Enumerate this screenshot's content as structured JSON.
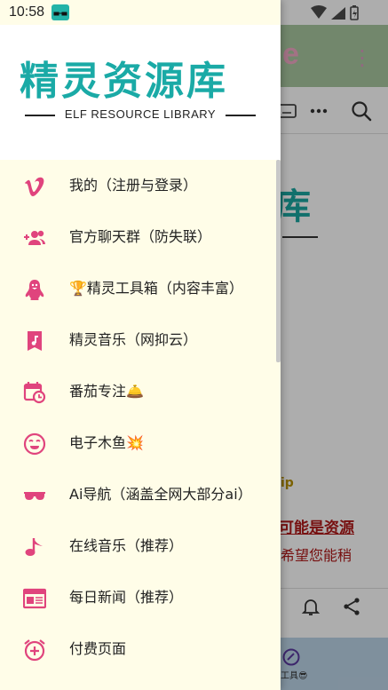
{
  "status_bar": {
    "time": "10:58"
  },
  "background_app": {
    "appbar_title": "e",
    "more": "⋮",
    "hero_title": "库",
    "tip_text": "ip",
    "red_text_1": "可能是资源",
    "red_text_2": "希望您能稍",
    "nav_label": "工具😎"
  },
  "drawer": {
    "logo": {
      "title": "精灵资源库",
      "subtitle": "ELF RESOURCE LIBRARY"
    },
    "menu": [
      {
        "label": "我的（注册与登录）",
        "icon": "vimeo-icon"
      },
      {
        "label": "官方聊天群（防失联）",
        "icon": "add-group-icon"
      },
      {
        "label": "🏆精灵工具箱（内容丰富）",
        "icon": "penguin-icon"
      },
      {
        "label": "精灵音乐（网抑云）",
        "icon": "music-note-icon"
      },
      {
        "label": "番茄专注🛎️",
        "icon": "calendar-clock-icon"
      },
      {
        "label": "电子木鱼💥",
        "icon": "emoji-tongue-icon"
      },
      {
        "label": "Ai导航（涵盖全网大部分ai）",
        "icon": "sunglasses-icon"
      },
      {
        "label": "在线音乐（推荐）",
        "icon": "eighth-note-icon"
      },
      {
        "label": "每日新闻（推荐）",
        "icon": "newspaper-icon"
      },
      {
        "label": "付费页面",
        "icon": "alarm-add-icon"
      }
    ]
  },
  "colors": {
    "accent": "#e0447d",
    "logo": "#1aaaa6",
    "drawer_bg": "#fffde8"
  }
}
